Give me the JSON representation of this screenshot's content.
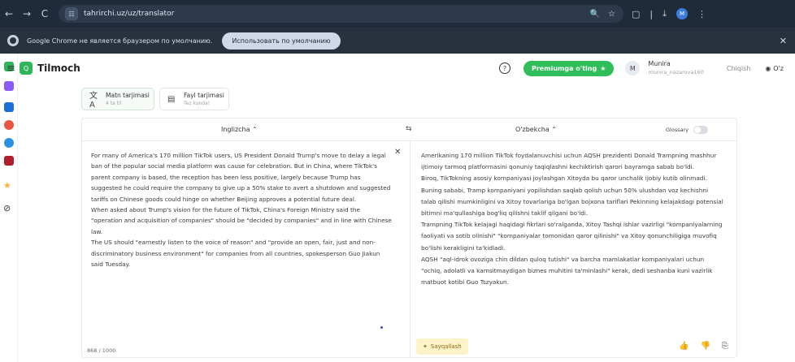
{
  "browser": {
    "url": "tahrirchi.uz/uz/translator",
    "nav_back": "←",
    "nav_forward": "→",
    "reload": "C",
    "site_settings": "☷",
    "zoom_icon": "🔍",
    "star_icon": "☆",
    "profile_initial": "M",
    "infobar_text": "Google Chrome не является браузером по умолчанию.",
    "infobar_button": "Использовать по умолчанию",
    "infobar_close": "✕"
  },
  "app": {
    "menu_glyph": "≡",
    "logo_glyph": "Q",
    "brand": "Tilmoch",
    "help_glyph": "?",
    "premium_label": "Premiumga o'ting",
    "premium_glyph": "★",
    "avatar_initial": "M",
    "user_name": "Munira",
    "user_email": "munira_nazarova160",
    "logout_label": "Chiqish",
    "ui_language": "O'z"
  },
  "modes": [
    {
      "title": "Matn tarjimasi",
      "subtitle": "4 ta til",
      "icon": "translate-icon",
      "glyph": "文A",
      "active": true
    },
    {
      "title": "Fayl tarjimasi",
      "subtitle": "Tez kunda!",
      "icon": "file-icon",
      "glyph": "▤",
      "active": false
    }
  ],
  "translator": {
    "source_language": "Inglizcha",
    "target_language": "O'zbekcha",
    "caret": "⌃",
    "swap_glyph": "⇆",
    "glossary_label": "Glossary",
    "clear_glyph": "✕",
    "source_paragraphs": [
      "For many of America's 170 million TikTok users, US President Donald Trump's move to delay a legal ban of the popular social media platform was cause for celebration. But in China, where TikTok's parent company is based, the reception has been less positive, largely because Trump has suggested he could require the company to give up a 50% stake to avert a shutdown and suggested tariffs on Chinese goods could hinge on whether Beijing approves a potential future deal.",
      "When asked about Trump's vision for the future of TikTok, China's Foreign Ministry said the \"operation and acquisition of companies\" should be \"decided by companies\" and in line with Chinese law.",
      "The US should \"earnestly listen to the voice of reason\" and \"provide an open, fair, just and non-discriminatory business environment\" for companies from all countries, spokesperson Guo Jiakun said Tuesday."
    ],
    "target_paragraphs": [
      "Amerikaning 170 million TikTok foydalanuvchisi uchun AQSH prezidenti Donald Trampning mashhur ijtimoiy tarmoq platformasini qonuniy taqiqlashni kechiktirish qarori bayramga sabab bo'ldi.",
      "Biroq, TikTokning asosiy kompaniyasi joylashgan Xitoyda bu qaror unchalik ijobiy kutib olinmadi. Buning sababi, Tramp kompaniyani yopilishdan saqlab qolish uchun 50% ulushdan voz kechishni talab qilishi mumkinligini va Xitoy tovarlariga bo'lgan bojxona tariflari Pekinning kelajakdagi potensial bitimni ma'qullashiga bog'liq qilishni taklif qilgani bo'ldi.",
      "Trampning TikTok kelajagi haqidagi fikrlari so'ralganda, Xitoy Tashqi ishlar vazirligi \"kompaniyalarning faoliyati va sotib olinishi\" \"kompaniyalar tomonidan qaror qilinishi\" va Xitoy qonunchiligiga muvofiq bo'lishi kerakligini ta'kidladi.",
      "AQSH \"aql-idrok ovoziga chin dildan quloq tutishi\" va barcha mamlakatlar kompaniyalari uchun \"ochiq, adolatli va kamsitmaydigan biznes muhitini ta'minlashi\" kerak, dedi seshanba kuni vazirlik matbuot kotibi Guo Tszyakun."
    ],
    "char_count": "868 / 1000",
    "speak_label": "Sayqallash",
    "speak_glyph": "✦",
    "like_glyph": "👍",
    "dislike_glyph": "👎",
    "copy_glyph": "⎘"
  },
  "colors": {
    "accent": "#2fbe5a",
    "browser_bg": "#1f2b3a"
  }
}
